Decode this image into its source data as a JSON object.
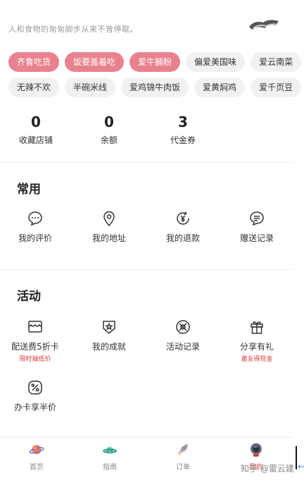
{
  "header": {
    "tagline": "人和食物的匆匆脚步从来不曾停歇。"
  },
  "tags": {
    "row1": [
      "齐鲁吃货",
      "饭要盖着吃",
      "爱牛腩粉",
      "偏爱美国味",
      "爱云南菜"
    ],
    "row2": [
      "无辣不欢",
      "半碗米线",
      "爱鸡锦牛肉饭",
      "爱黄焖鸡",
      "爱千页豆"
    ],
    "active_color": "#e9828e"
  },
  "stats": [
    {
      "value": "0",
      "label": "收藏店铺"
    },
    {
      "value": "0",
      "label": "余额"
    },
    {
      "value": "3",
      "label": "代金券"
    }
  ],
  "common": {
    "title": "常用",
    "items": [
      {
        "label": "我的评价",
        "icon": "comment-icon"
      },
      {
        "label": "我的地址",
        "icon": "location-pin-icon"
      },
      {
        "label": "我的退款",
        "icon": "refund-yuan-icon"
      },
      {
        "label": "赠送记录",
        "icon": "gift-record-icon"
      }
    ]
  },
  "activity": {
    "title": "活动",
    "items": [
      {
        "label": "配送费5折卡",
        "sub": "限时抽低价",
        "icon": "delivery-card-icon"
      },
      {
        "label": "我的成就",
        "sub": "",
        "icon": "medal-icon"
      },
      {
        "label": "活动记录",
        "sub": "",
        "icon": "activity-record-icon"
      },
      {
        "label": "分享有礼",
        "sub": "邀友得现金",
        "icon": "gift-box-icon"
      },
      {
        "label": "办卡享半价",
        "sub": "",
        "icon": "percent-icon"
      }
    ],
    "sub_color": "#d23c3c"
  },
  "tabbar": {
    "tabs": [
      {
        "label": "首页",
        "icon": "planet-icon"
      },
      {
        "label": "指南",
        "icon": "ufo-icon"
      },
      {
        "label": "订单",
        "icon": "rocket-icon"
      },
      {
        "label": "我的",
        "icon": "astronaut-icon"
      }
    ],
    "active_index": 3
  },
  "watermark": "知乎 @雷云建"
}
